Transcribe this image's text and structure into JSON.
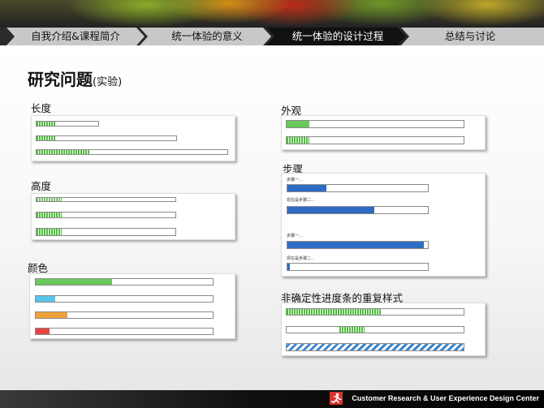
{
  "nav": {
    "items": [
      {
        "label": "自我介绍&课程简介",
        "active": false
      },
      {
        "label": "统一体验的意义",
        "active": false
      },
      {
        "label": "统一体验的设计过程",
        "active": true
      },
      {
        "label": "总结与讨论",
        "active": false
      }
    ]
  },
  "title": {
    "main": "研究问题",
    "sub": "(实验)"
  },
  "sections": {
    "length": {
      "label": "长度",
      "fills": [
        0.3,
        0.14,
        0.28
      ]
    },
    "height": {
      "label": "高度",
      "fills": [
        0.18,
        0.18,
        0.18
      ]
    },
    "color": {
      "label": "颜色",
      "colors": [
        "#6ac95a",
        "#5bc4ec",
        "#f0a03a",
        "#e84545"
      ],
      "fills": [
        0.43,
        0.11,
        0.18,
        0.08
      ]
    },
    "appearance": {
      "label": "外观",
      "fills": [
        0.13,
        0.13
      ]
    },
    "steps": {
      "label": "步骤",
      "color": "#2f6cc4",
      "group1": {
        "step1": "步骤一...",
        "step2": "现在是步骤二..."
      },
      "group2": {
        "step1": "步骤一...",
        "step2": "现在是步骤二..."
      },
      "fills": [
        0.28,
        0.62,
        0.97,
        0.02
      ]
    },
    "indeterminate": {
      "label": "非确定性进度条的重复样式"
    }
  },
  "footer": {
    "text": "Customer Research & User Experience Design Center"
  }
}
